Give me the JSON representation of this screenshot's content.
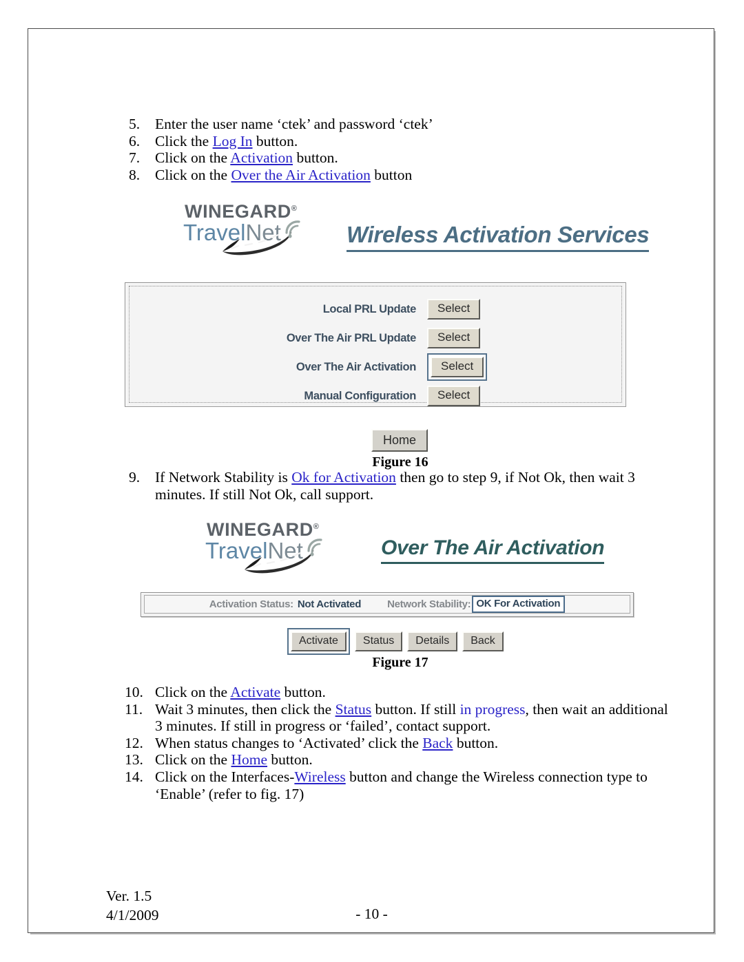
{
  "document": {
    "figures": {
      "figure16_caption": "Figure 16",
      "figure17_caption": "Figure 17"
    },
    "footer": {
      "version": "Ver. 1.5",
      "date": "4/1/2009",
      "page_number": "- 10 -"
    }
  },
  "steps_top": [
    {
      "num": "5.",
      "parts": [
        {
          "text": "Enter the user name ‘ctek’ and password ‘ctek’",
          "style": "plain"
        }
      ]
    },
    {
      "num": "6.",
      "parts": [
        {
          "text": "Click the ",
          "style": "plain"
        },
        {
          "text": "Log In",
          "style": "link"
        },
        {
          "text": " button.",
          "style": "plain"
        }
      ]
    },
    {
      "num": "7.",
      "parts": [
        {
          "text": "Click on the ",
          "style": "plain"
        },
        {
          "text": "Activation",
          "style": "link"
        },
        {
          "text": " button.",
          "style": "plain"
        }
      ]
    },
    {
      "num": "8.",
      "parts": [
        {
          "text": "Click on the ",
          "style": "plain"
        },
        {
          "text": "Over the Air Activation",
          "style": "link"
        },
        {
          "text": " button",
          "style": "plain"
        }
      ]
    }
  ],
  "steps_mid": [
    {
      "num": "9.",
      "parts": [
        {
          "text": "If Network Stability is ",
          "style": "plain"
        },
        {
          "text": "Ok for Activation",
          "style": "link"
        },
        {
          "text": " then go to step 9, if Not Ok, then wait 3 minutes.  If still Not Ok, call support.",
          "style": "plain"
        }
      ]
    }
  ],
  "steps_bottom": [
    {
      "num": "10.",
      "parts": [
        {
          "text": "Click on the ",
          "style": "plain"
        },
        {
          "text": "Activate",
          "style": "link"
        },
        {
          "text": " button.",
          "style": "plain"
        }
      ]
    },
    {
      "num": "11.",
      "parts": [
        {
          "text": " Wait 3 minutes, then click the ",
          "style": "plain"
        },
        {
          "text": "Status",
          "style": "link"
        },
        {
          "text": " button.   If still ",
          "style": "plain"
        },
        {
          "text": "in progress",
          "style": "link-plain"
        },
        {
          "text": ", then wait an additional 3 minutes.  If still in progress or ‘failed’, contact support.",
          "style": "plain"
        }
      ]
    },
    {
      "num": "12.",
      "parts": [
        {
          "text": "When status changes to ‘Activated’ click the ",
          "style": "plain"
        },
        {
          "text": "Back",
          "style": "link"
        },
        {
          "text": " button.",
          "style": "plain"
        }
      ]
    },
    {
      "num": "13.",
      "parts": [
        {
          "text": "Click on the ",
          "style": "plain"
        },
        {
          "text": "Home",
          "style": "link"
        },
        {
          "text": " button.",
          "style": "plain"
        }
      ]
    },
    {
      "num": "14.",
      "parts": [
        {
          "text": "Click on the Interfaces-",
          "style": "plain"
        },
        {
          "text": "Wireless",
          "style": "link"
        },
        {
          "text": " button and  change the Wireless connection type to ‘Enable’ (refer to fig. 17)",
          "style": "plain"
        }
      ]
    }
  ],
  "logo": {
    "brand": "WINEGARD",
    "brand_trademark": "®",
    "product_travel": "Travel",
    "product_net": "Net",
    "brand_color": "#5c6268",
    "travel_color": "#5d86a5",
    "net_color": "#7c8a93"
  },
  "screen_activation_services": {
    "title": "Wireless Activation Services",
    "title_color": "#4c6e84",
    "options": [
      {
        "label": "Local PRL Update",
        "button_label": "Select",
        "focused": false
      },
      {
        "label": "Over The Air PRL Update",
        "button_label": "Select",
        "focused": false
      },
      {
        "label": "Over The Air Activation",
        "button_label": "Select",
        "focused": true
      },
      {
        "label": "Manual Configuration",
        "button_label": "Select",
        "focused": false
      }
    ],
    "home_button_label": "Home",
    "focus_ring_color": "#55728c",
    "label_color": "#3d4f60"
  },
  "screen_over_the_air_activation": {
    "title": "Over The Air Activation",
    "title_color": "#2f5d5e",
    "status": {
      "activation_status_label": "Activation Status:",
      "activation_status_value": "Not Activated",
      "network_stability_label": "Network Stability:",
      "network_stability_value": "OK For Activation",
      "label_color": "#84888c",
      "value_color": "#2f4559",
      "highlight_border_color": "#4b6c8b"
    },
    "buttons": [
      {
        "label": "Activate",
        "focused": true
      },
      {
        "label": "Status",
        "focused": false
      },
      {
        "label": "Details",
        "focused": false
      },
      {
        "label": "Back",
        "focused": false
      }
    ]
  }
}
